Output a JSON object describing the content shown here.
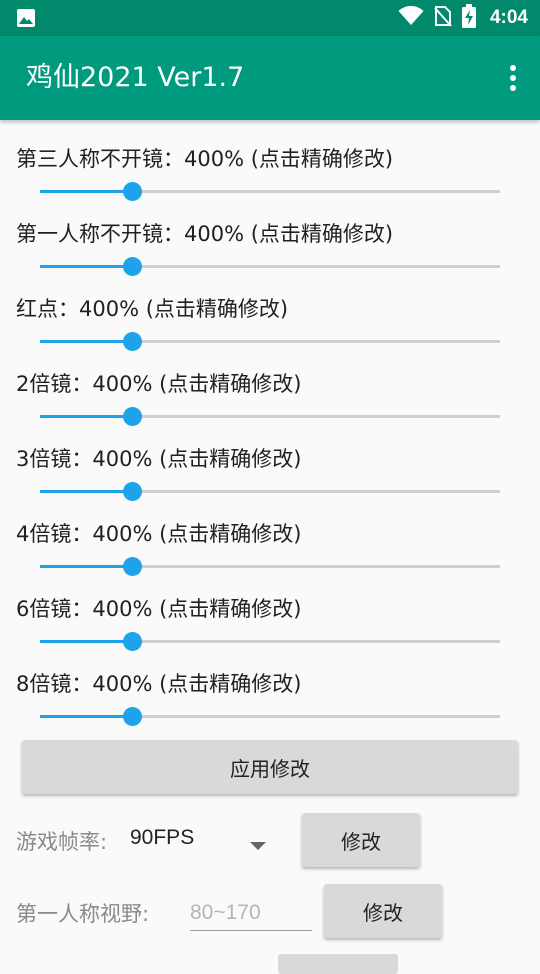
{
  "status_bar": {
    "time": "4:04",
    "icons": [
      "image-icon",
      "wifi-icon",
      "no-sim-icon",
      "battery-charging-icon"
    ]
  },
  "app_bar": {
    "title": "鸡仙2021 Ver1.7",
    "menu_icon": "more-vertical-icon"
  },
  "colors": {
    "status_bar": "#00896b",
    "app_bar": "#009a7f",
    "slider_accent": "#1ea3ea",
    "slider_track": "#cfcfcf",
    "button_bg": "#d9d9d9"
  },
  "sliders": [
    {
      "label": "第三人称不开镜：400%   (点击精确修改)",
      "value_fraction": 0.2
    },
    {
      "label": "第一人称不开镜：400%   (点击精确修改)",
      "value_fraction": 0.2
    },
    {
      "label": "红点：400%   (点击精确修改)",
      "value_fraction": 0.2
    },
    {
      "label": "2倍镜：400%   (点击精确修改)",
      "value_fraction": 0.2
    },
    {
      "label": "3倍镜：400%   (点击精确修改)",
      "value_fraction": 0.2
    },
    {
      "label": "4倍镜：400%   (点击精确修改)",
      "value_fraction": 0.2
    },
    {
      "label": "6倍镜：400%   (点击精确修改)",
      "value_fraction": 0.2
    },
    {
      "label": "8倍镜：400%   (点击精确修改)",
      "value_fraction": 0.2
    }
  ],
  "apply_button": {
    "label": "应用修改"
  },
  "fps": {
    "label": "游戏帧率:",
    "selected": "90FPS",
    "button_label": "修改"
  },
  "fov": {
    "label": "第一人称视野:",
    "placeholder": "80~170",
    "value": "",
    "button_label": "修改"
  }
}
